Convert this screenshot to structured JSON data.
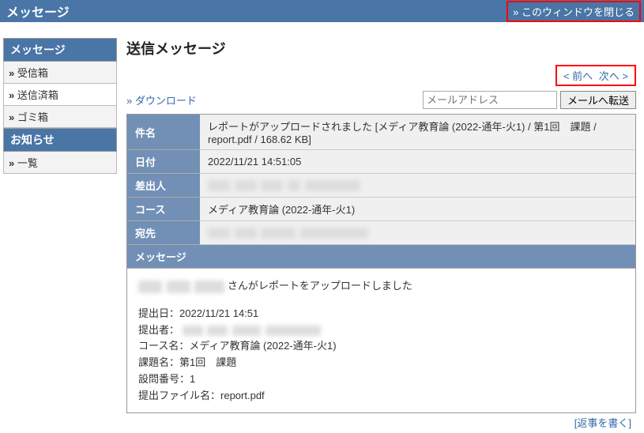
{
  "topbar": {
    "title": "メッセージ",
    "close_label": "» このウィンドウを閉じる"
  },
  "sidebar": {
    "sections": [
      {
        "title": "メッセージ",
        "items": [
          {
            "marker": "»",
            "label": "受信箱",
            "active": false
          },
          {
            "marker": "»",
            "label": "送信済箱",
            "active": true
          },
          {
            "marker": "»",
            "label": "ゴミ箱",
            "active": false
          }
        ]
      },
      {
        "title": "お知らせ",
        "items": [
          {
            "marker": "»",
            "label": "一覧",
            "active": false
          }
        ]
      }
    ]
  },
  "content": {
    "heading": "送信メッセージ",
    "nav_prev": "< 前へ",
    "nav_next": "次へ >",
    "download_label": "» ダウンロード",
    "mail_placeholder": "メールアドレス",
    "forward_button": "メールへ転送",
    "fields": {
      "subject_label": "件名",
      "subject_value": "レポートがアップロードされました [メディア教育論 (2022-通年-火1) / 第1回　課題 / report.pdf / 168.62 KB]",
      "date_label": "日付",
      "date_value": "2022/11/21 14:51:05",
      "sender_label": "差出人",
      "course_label": "コース",
      "course_value": "メディア教育論 (2022-通年-火1)",
      "recipient_label": "宛先"
    },
    "message_header": "メッセージ",
    "body": {
      "lead_tail": " さんがレポートをアップロードしました",
      "line_submit_date_label": "提出日：",
      "line_submit_date_value": "2022/11/21 14:51",
      "line_submitter_label": "提出者：",
      "line_course_label": "コース名：",
      "line_course_value": "メディア教育論 (2022-通年-火1)",
      "line_task_label": "課題名：",
      "line_task_value": "第1回　課題",
      "line_qno_label": "設問番号：",
      "line_qno_value": "1",
      "line_file_label": "提出ファイル名：",
      "line_file_value": "report.pdf"
    },
    "reply_label": "[返事を書く]"
  }
}
